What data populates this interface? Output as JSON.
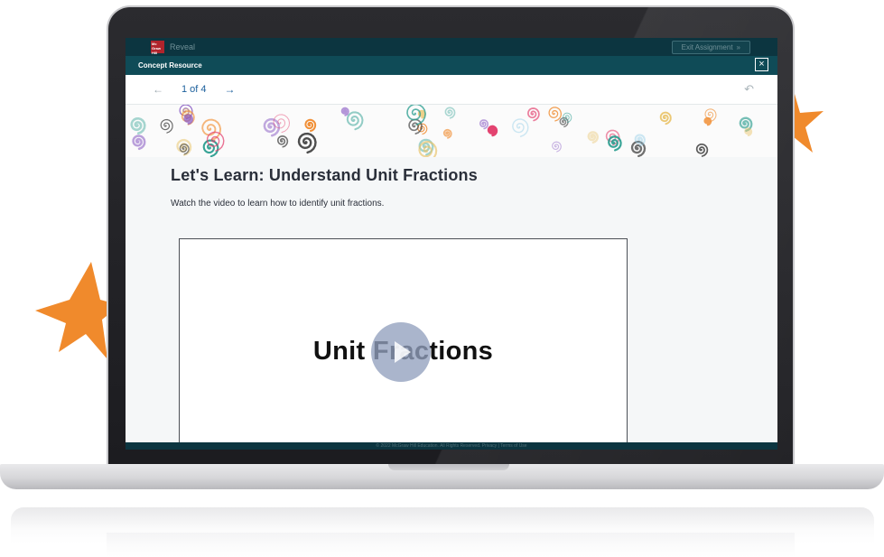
{
  "app": {
    "brand": "Mc Graw Hill",
    "name": "Reveal",
    "exit_label": "Exit Assignment",
    "exit_chevron": "»"
  },
  "modal": {
    "title": "Concept Resource",
    "close_label": "×"
  },
  "nav": {
    "prev_icon": "←",
    "page": "1 of 4",
    "next_icon": "→",
    "undo_icon": "↶"
  },
  "lesson": {
    "title": "Let's Learn: Understand Unit Fractions",
    "description": "Watch the video to learn how to identify unit fractions."
  },
  "video": {
    "title": "Unit Fractions"
  },
  "footer": {
    "text": "© 2022 McGraw Hill Education. All Rights Reserved.   Privacy   |   Terms of Use"
  },
  "colors": {
    "star": "#f08a2c",
    "header": "#0f4b57",
    "link": "#1b5f9c",
    "swirl_palette": [
      "#e23b6a",
      "#f08a2c",
      "#e9c46a",
      "#2a9d8f",
      "#8ecae6",
      "#8a5cc4",
      "#444444"
    ]
  },
  "icons": [
    "star-icon",
    "arrow-left-icon",
    "arrow-right-icon",
    "undo-icon",
    "close-icon",
    "play-icon",
    "swirl-pattern"
  ]
}
